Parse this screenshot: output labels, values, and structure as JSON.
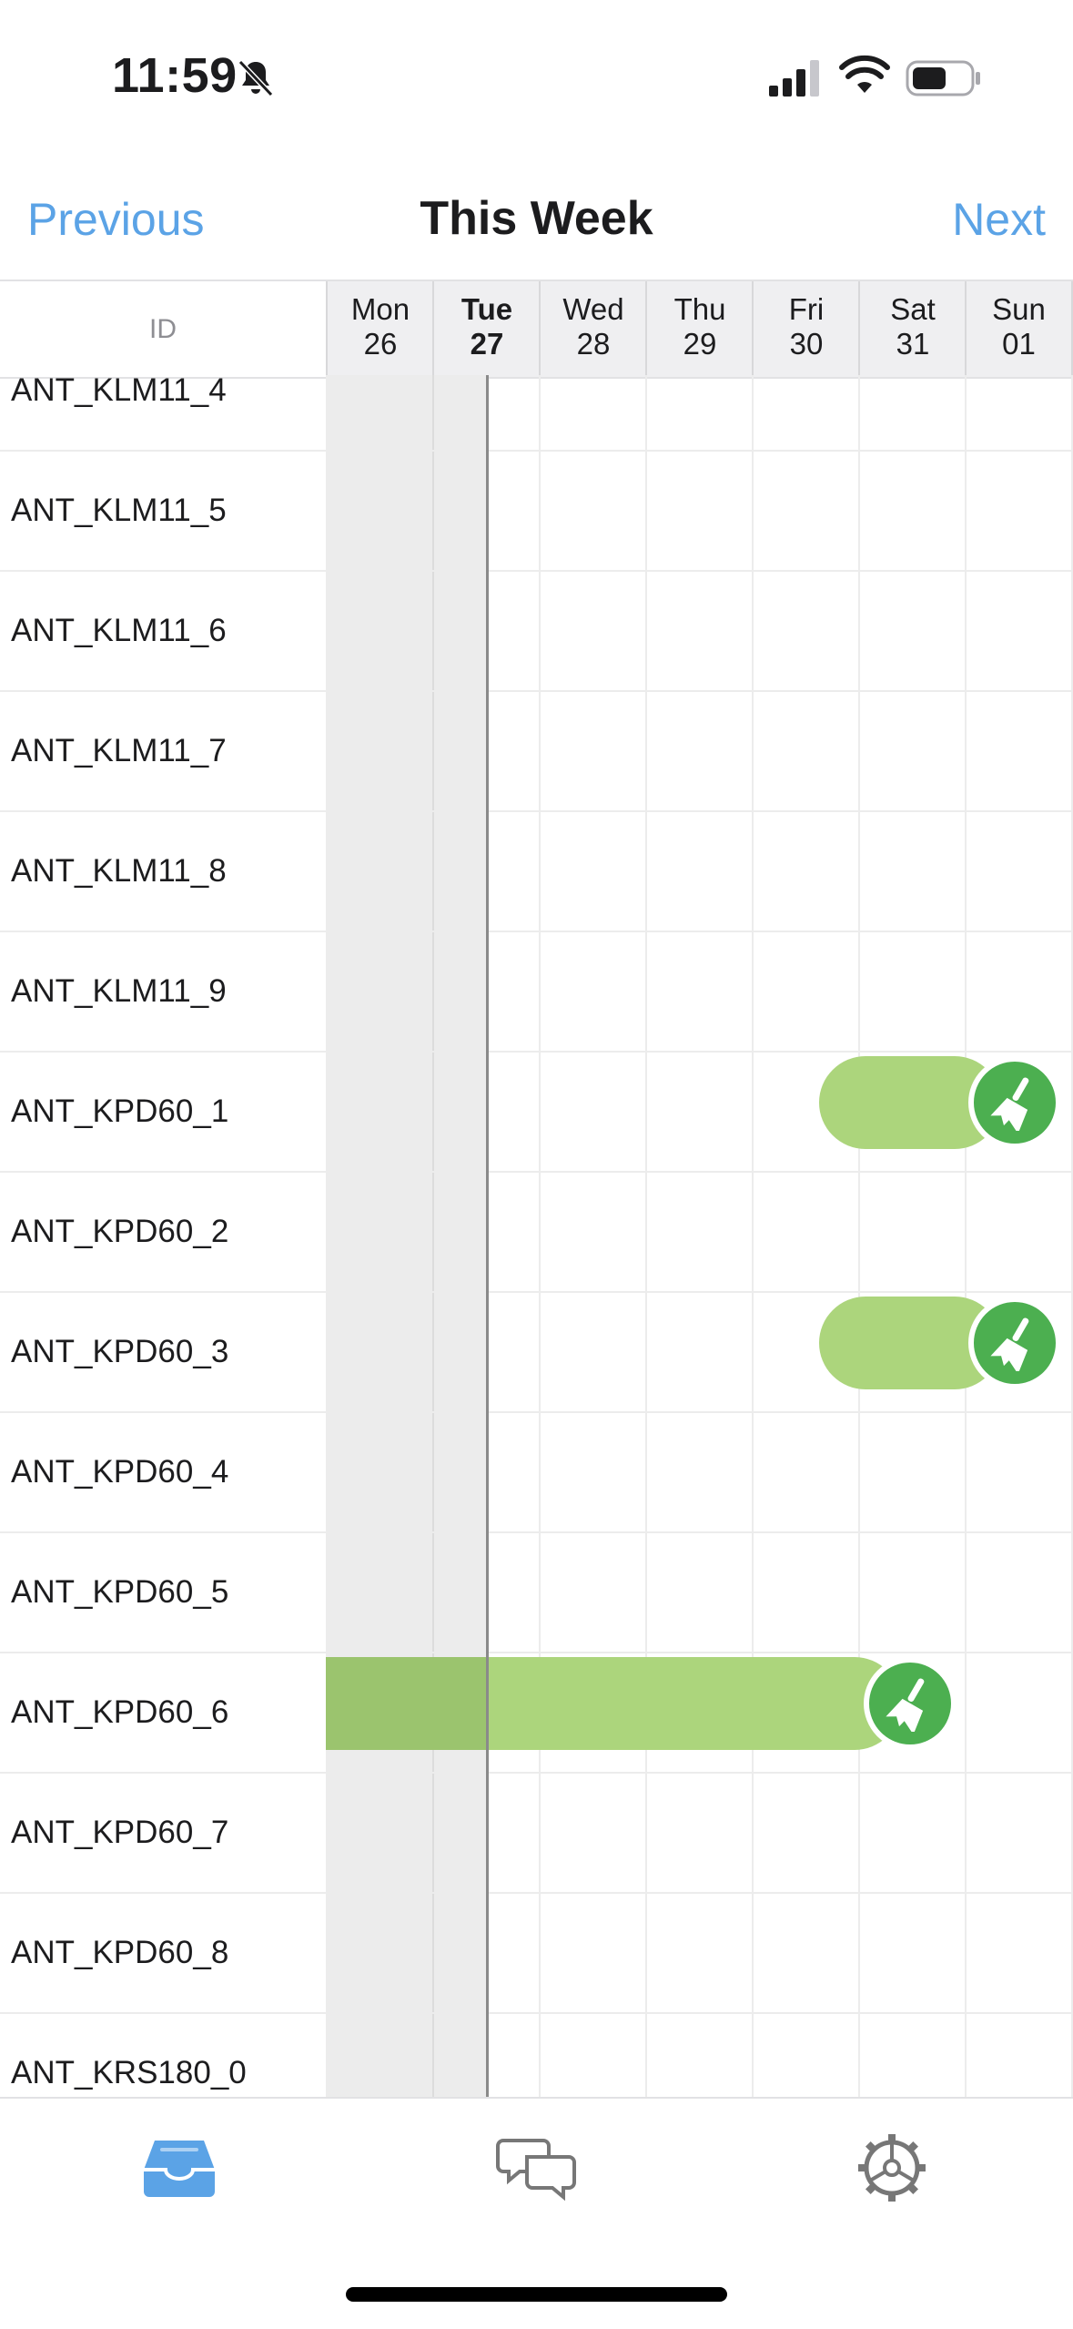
{
  "status_bar": {
    "time": "11:59"
  },
  "nav": {
    "previous_label": "Previous",
    "title": "This Week",
    "next_label": "Next"
  },
  "table": {
    "id_header": "ID",
    "days": [
      {
        "name": "Mon",
        "date": "26",
        "today": false
      },
      {
        "name": "Tue",
        "date": "27",
        "today": true
      },
      {
        "name": "Wed",
        "date": "28",
        "today": false
      },
      {
        "name": "Thu",
        "date": "29",
        "today": false
      },
      {
        "name": "Fri",
        "date": "30",
        "today": false
      },
      {
        "name": "Sat",
        "date": "31",
        "today": false
      },
      {
        "name": "Sun",
        "date": "01",
        "today": false
      }
    ],
    "rows": [
      {
        "id": "ANT_KLM11_4"
      },
      {
        "id": "ANT_KLM11_5"
      },
      {
        "id": "ANT_KLM11_6"
      },
      {
        "id": "ANT_KLM11_7"
      },
      {
        "id": "ANT_KLM11_8"
      },
      {
        "id": "ANT_KLM11_9"
      },
      {
        "id": "ANT_KPD60_1"
      },
      {
        "id": "ANT_KPD60_2"
      },
      {
        "id": "ANT_KPD60_3"
      },
      {
        "id": "ANT_KPD60_4"
      },
      {
        "id": "ANT_KPD60_5"
      },
      {
        "id": "ANT_KPD60_6"
      },
      {
        "id": "ANT_KPD60_7"
      },
      {
        "id": "ANT_KPD60_8"
      },
      {
        "id": "ANT_KRS180_0"
      }
    ],
    "events": [
      {
        "row_id": "ANT_KPD60_1",
        "start_day": "Fri",
        "end_day": "Sun",
        "icon": "broom-icon",
        "color": "#acd57c"
      },
      {
        "row_id": "ANT_KPD60_3",
        "start_day": "Fri",
        "end_day": "Sun",
        "icon": "broom-icon",
        "color": "#acd57c"
      },
      {
        "row_id": "ANT_KPD60_6",
        "start_day": "before Mon",
        "end_day": "Sat",
        "icon": "broom-icon",
        "color": "#acd57c"
      }
    ]
  },
  "tab_bar": {
    "tabs": [
      {
        "icon": "inbox-tray-icon",
        "active": true
      },
      {
        "icon": "chat-bubbles-icon",
        "active": false
      },
      {
        "icon": "gear-icon",
        "active": false
      }
    ]
  },
  "colors": {
    "accent": "#5ba3e6",
    "event_bar": "#acd57c",
    "event_badge": "#4caf50",
    "past_shade": "#ececec"
  }
}
